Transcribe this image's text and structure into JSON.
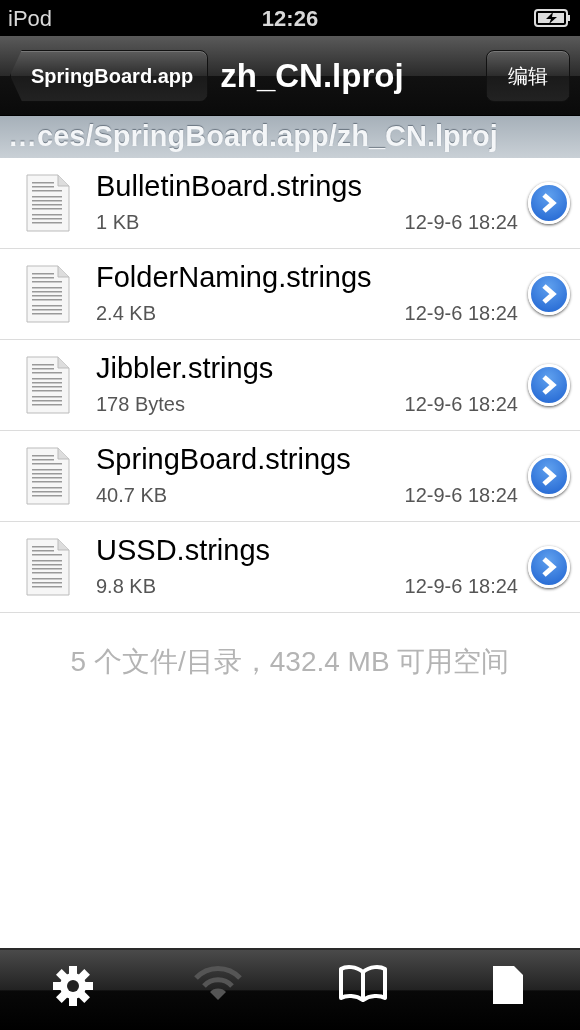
{
  "status_bar": {
    "carrier": "iPod",
    "time": "12:26"
  },
  "nav_bar": {
    "back": "SpringBoard.app",
    "title": "zh_CN.lproj",
    "edit": "编辑"
  },
  "path": "…ces/SpringBoard.app/zh_CN.lproj",
  "files": [
    {
      "name": "BulletinBoard.strings",
      "size": "1 KB",
      "date": "12-9-6 18:24"
    },
    {
      "name": "FolderNaming.strings",
      "size": "2.4 KB",
      "date": "12-9-6 18:24"
    },
    {
      "name": "Jibbler.strings",
      "size": "178 Bytes",
      "date": "12-9-6 18:24"
    },
    {
      "name": "SpringBoard.strings",
      "size": "40.7 KB",
      "date": "12-9-6 18:24"
    },
    {
      "name": "USSD.strings",
      "size": "9.8 KB",
      "date": "12-9-6 18:24"
    }
  ],
  "summary": "5 个文件/目录，432.4 MB 可用空间",
  "tab_bar": [
    {
      "kind": "gear",
      "disabled": false
    },
    {
      "kind": "wifi",
      "disabled": true
    },
    {
      "kind": "book",
      "disabled": false
    },
    {
      "kind": "document",
      "disabled": false
    }
  ]
}
